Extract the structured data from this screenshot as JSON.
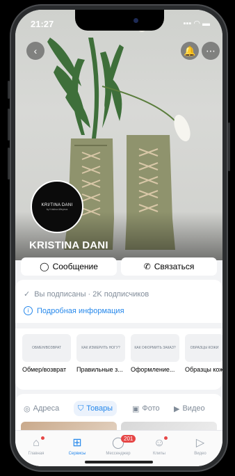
{
  "status": {
    "time": "21:27",
    "signal": "▪▪▪ ◠ ▬"
  },
  "profile": {
    "avatar_text": "KRI/TINA DANI",
    "avatar_subtext": "by Kristina Alfeyeva",
    "name": "KRISTINA DANI"
  },
  "actions": {
    "message": "Сообщение",
    "contact": "Связаться"
  },
  "subscription": {
    "text": "Вы подписаны · 2K подписчиков",
    "info_link": "Подробная информация"
  },
  "services": [
    {
      "tile": "ОБМЕН/ВОЗВРАТ",
      "label": "Обмер/возврат"
    },
    {
      "tile": "КАК ИЗМЕРИТЬ НОГУ?",
      "label": "Правильные з..."
    },
    {
      "tile": "КАК ОФОРМИТЬ ЗАКАЗ?",
      "label": "Оформление..."
    },
    {
      "tile": "ОБРАЗЦЫ КОЖИ",
      "label": "Образцы кож"
    }
  ],
  "tabs": [
    {
      "label": "Адреса",
      "icon": "map-pin-icon"
    },
    {
      "label": "Товары",
      "icon": "shopping-bag-icon"
    },
    {
      "label": "Фото",
      "icon": "photo-icon"
    },
    {
      "label": "Видео",
      "icon": "video-icon"
    }
  ],
  "bottom_nav": [
    {
      "label": "Главная",
      "icon": "home-icon"
    },
    {
      "label": "Сервисы",
      "icon": "grid-icon"
    },
    {
      "label": "Мессенджер",
      "icon": "chat-icon",
      "badge": "201"
    },
    {
      "label": "Клипы",
      "icon": "clips-icon"
    },
    {
      "label": "Видео",
      "icon": "video-icon"
    }
  ],
  "colors": {
    "accent": "#2688eb",
    "badge": "#e64646"
  }
}
